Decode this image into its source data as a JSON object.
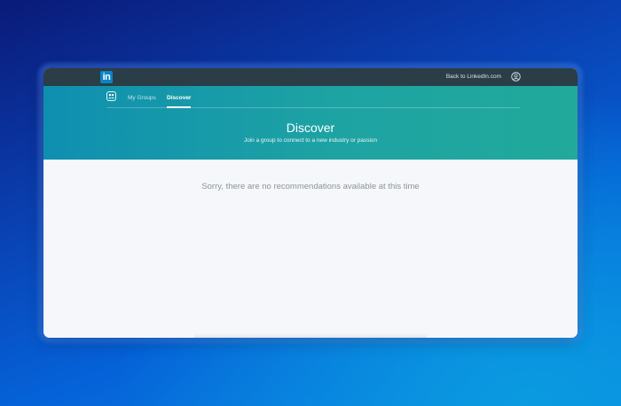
{
  "header": {
    "logo_text": "in",
    "back_link": "Back to LinkedIn.com"
  },
  "subnav": {
    "tabs": [
      {
        "label": "My Groups",
        "active": false
      },
      {
        "label": "Discover",
        "active": true
      }
    ]
  },
  "hero": {
    "title": "Discover",
    "subtitle": "Join a group to connect to a new industry or passion"
  },
  "main": {
    "empty_message": "Sorry, there are no recommendations available at this time"
  },
  "colors": {
    "topbar": "#2b3d46",
    "hero_start": "#0f8fb0",
    "hero_end": "#21a99b",
    "logo": "#0a84c6",
    "content_bg": "#f5f7fa"
  },
  "icons": {
    "groups": "groups-icon",
    "profile": "profile-icon"
  }
}
